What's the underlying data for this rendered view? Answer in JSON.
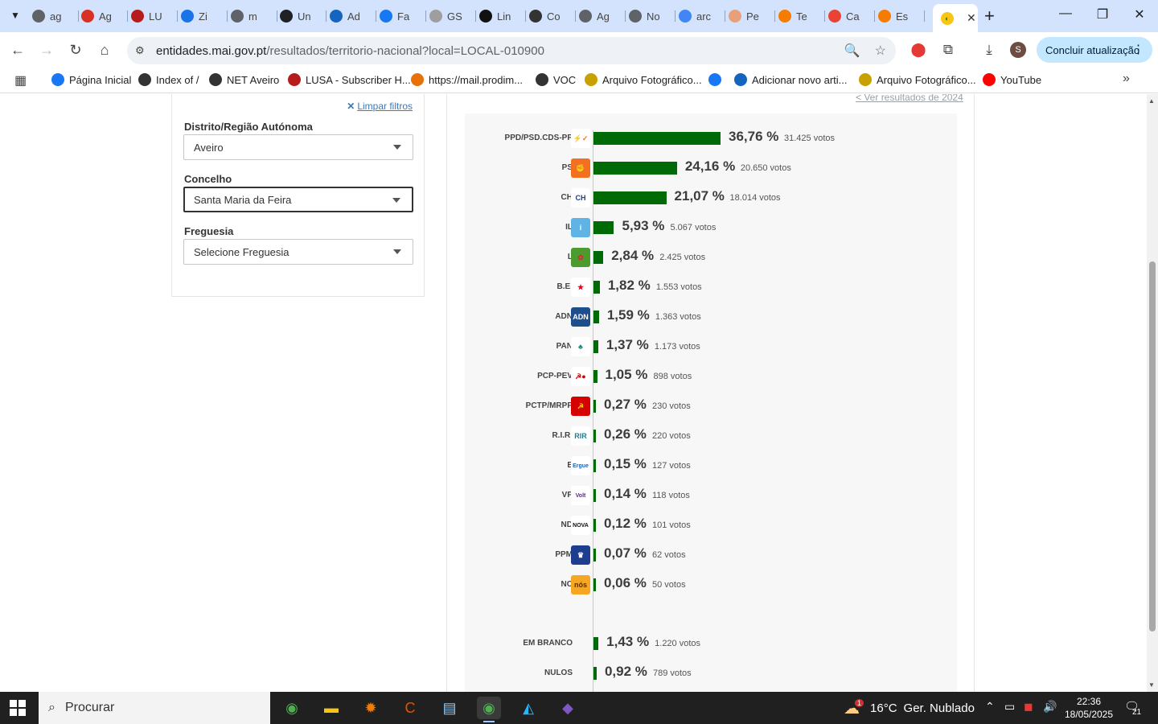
{
  "browser": {
    "tabs": [
      {
        "label": "ag",
        "color": "#5f6368"
      },
      {
        "label": "Ag",
        "color": "#d93025"
      },
      {
        "label": "LU",
        "color": "#b71c1c"
      },
      {
        "label": "Zi",
        "color": "#1a73e8"
      },
      {
        "label": "m",
        "color": "#5f6368"
      },
      {
        "label": "Un",
        "color": "#202124"
      },
      {
        "label": "Ad",
        "color": "#1565c0"
      },
      {
        "label": "Fa",
        "color": "#1877f2"
      },
      {
        "label": "GS",
        "color": "#9e9e9e"
      },
      {
        "label": "Lin",
        "color": "#111111"
      },
      {
        "label": "Co",
        "color": "#333333"
      },
      {
        "label": "Ag",
        "color": "#5f6368"
      },
      {
        "label": "No",
        "color": "#5f6368"
      },
      {
        "label": "arc",
        "color": "#4285f4"
      },
      {
        "label": "Pe",
        "color": "#e8a07a"
      },
      {
        "label": "Te",
        "color": "#f57c00"
      },
      {
        "label": "Ca",
        "color": "#ea4335"
      },
      {
        "label": "Es",
        "color": "#f57c00"
      }
    ],
    "active_tab_close": "✕",
    "new_tab": "+",
    "url_domain": "entidades.mai.gov.pt",
    "url_path": "/resultados/territorio-nacional?local=LOCAL-010900",
    "update_button": "Concluir atualização",
    "avatar_letter": "S",
    "bookmarks": [
      {
        "label": "Página Inicial",
        "icon": "facebook-icon",
        "color": "#1877f2"
      },
      {
        "label": "Index of /",
        "icon": "globe-icon",
        "color": "#333333"
      },
      {
        "label": "NET Aveiro",
        "icon": "globe-icon",
        "color": "#333333"
      },
      {
        "label": "LUSA - Subscriber H...",
        "icon": "lusa-icon",
        "color": "#b71c1c"
      },
      {
        "label": "https://mail.prodim...",
        "icon": "zimbra-icon",
        "color": "#e8710a"
      },
      {
        "label": "VOC",
        "icon": "globe-icon",
        "color": "#333333"
      },
      {
        "label": "Arquivo Fotográfico...",
        "icon": "archive-icon",
        "color": "#c8a000"
      },
      {
        "label": "",
        "icon": "facebook-icon",
        "color": "#1877f2"
      },
      {
        "label": "Adicionar novo arti...",
        "icon": "da-icon",
        "color": "#1565c0"
      },
      {
        "label": "Arquivo Fotográfico...",
        "icon": "archive-icon",
        "color": "#c8a000"
      },
      {
        "label": "YouTube",
        "icon": "youtube-icon",
        "color": "#ff0000"
      }
    ]
  },
  "filters": {
    "clear_label": "Limpar filtros",
    "district_label": "Distrito/Região Autónoma",
    "district_value": "Aveiro",
    "county_label": "Concelho",
    "county_value": "Santa Maria da Feira",
    "parish_label": "Freguesia",
    "parish_placeholder": "Selecione Freguesia"
  },
  "results": {
    "previous_link": "< Ver resultados de 2024",
    "parties": [
      {
        "name": "PPD/PSD.CDS-PP",
        "pct": "36,76 %",
        "votes": "31.425 votos",
        "share": 36.76,
        "logo_bg": "#ffffff",
        "logo_fg": "#f37021",
        "logo_text": "⚡✓"
      },
      {
        "name": "PS",
        "pct": "24,16 %",
        "votes": "20.650 votos",
        "share": 24.16,
        "logo_bg": "#f37021",
        "logo_fg": "#ffd400",
        "logo_text": "✊"
      },
      {
        "name": "CH",
        "pct": "21,07 %",
        "votes": "18.014 votos",
        "share": 21.07,
        "logo_bg": "#ffffff",
        "logo_fg": "#1d3d8f",
        "logo_text": "CH"
      },
      {
        "name": "IL",
        "pct": "5,93 %",
        "votes": "5.067 votos",
        "share": 5.93,
        "logo_bg": "#5fb4e5",
        "logo_fg": "#ffffff",
        "logo_text": "i"
      },
      {
        "name": "L",
        "pct": "2,84 %",
        "votes": "2.425 votos",
        "share": 2.84,
        "logo_bg": "#4b9b2f",
        "logo_fg": "#d32f2f",
        "logo_text": "✿"
      },
      {
        "name": "B.E.",
        "pct": "1,82 %",
        "votes": "1.553 votos",
        "share": 1.82,
        "logo_bg": "#ffffff",
        "logo_fg": "#e3001b",
        "logo_text": "★"
      },
      {
        "name": "ADN",
        "pct": "1,59 %",
        "votes": "1.363 votos",
        "share": 1.59,
        "logo_bg": "#1f4e8c",
        "logo_fg": "#ffffff",
        "logo_text": "ADN"
      },
      {
        "name": "PAN",
        "pct": "1,37 %",
        "votes": "1.173 votos",
        "share": 1.37,
        "logo_bg": "#ffffff",
        "logo_fg": "#0a8a7a",
        "logo_text": "♣"
      },
      {
        "name": "PCP-PEV",
        "pct": "1,05 %",
        "votes": "898 votos",
        "share": 1.05,
        "logo_bg": "#ffffff",
        "logo_fg": "#d50000",
        "logo_text": "☭●"
      },
      {
        "name": "PCTP/MRPP",
        "pct": "0,27 %",
        "votes": "230 votos",
        "share": 0.27,
        "logo_bg": "#d50000",
        "logo_fg": "#ffd400",
        "logo_text": "☭"
      },
      {
        "name": "R.I.R.",
        "pct": "0,26 %",
        "votes": "220 votos",
        "share": 0.26,
        "logo_bg": "#ffffff",
        "logo_fg": "#1a7f8e",
        "logo_text": "RIR"
      },
      {
        "name": "E",
        "pct": "0,15 %",
        "votes": "127 votos",
        "share": 0.15,
        "logo_bg": "#ffffff",
        "logo_fg": "#1565c0",
        "logo_text": "Ergue"
      },
      {
        "name": "VP",
        "pct": "0,14 %",
        "votes": "118 votos",
        "share": 0.14,
        "logo_bg": "#ffffff",
        "logo_fg": "#5b2a86",
        "logo_text": "Volt"
      },
      {
        "name": "ND",
        "pct": "0,12 %",
        "votes": "101 votos",
        "share": 0.12,
        "logo_bg": "#ffffff",
        "logo_fg": "#111111",
        "logo_text": "NOVA"
      },
      {
        "name": "PPM",
        "pct": "0,07 %",
        "votes": "62 votos",
        "share": 0.07,
        "logo_bg": "#1d3d8f",
        "logo_fg": "#ffffff",
        "logo_text": "♛"
      },
      {
        "name": "NC",
        "pct": "0,06 %",
        "votes": "50 votos",
        "share": 0.06,
        "logo_bg": "#f5a623",
        "logo_fg": "#5a2d00",
        "logo_text": "nós"
      },
      {
        "name": "EM BRANCO",
        "pct": "1,43 %",
        "votes": "1.220 votos",
        "share": 1.43,
        "logo_bg": "",
        "logo_fg": "",
        "logo_text": ""
      },
      {
        "name": "NULOS",
        "pct": "0,92 %",
        "votes": "789 votos",
        "share": 0.92,
        "logo_bg": "",
        "logo_fg": "",
        "logo_text": ""
      }
    ]
  },
  "taskbar": {
    "search_placeholder": "Procurar",
    "weather_temp": "16°C",
    "weather_desc": "Ger. Nublado",
    "weather_badge": "1",
    "time": "22:36",
    "date": "18/05/2025",
    "notifications": "21"
  }
}
